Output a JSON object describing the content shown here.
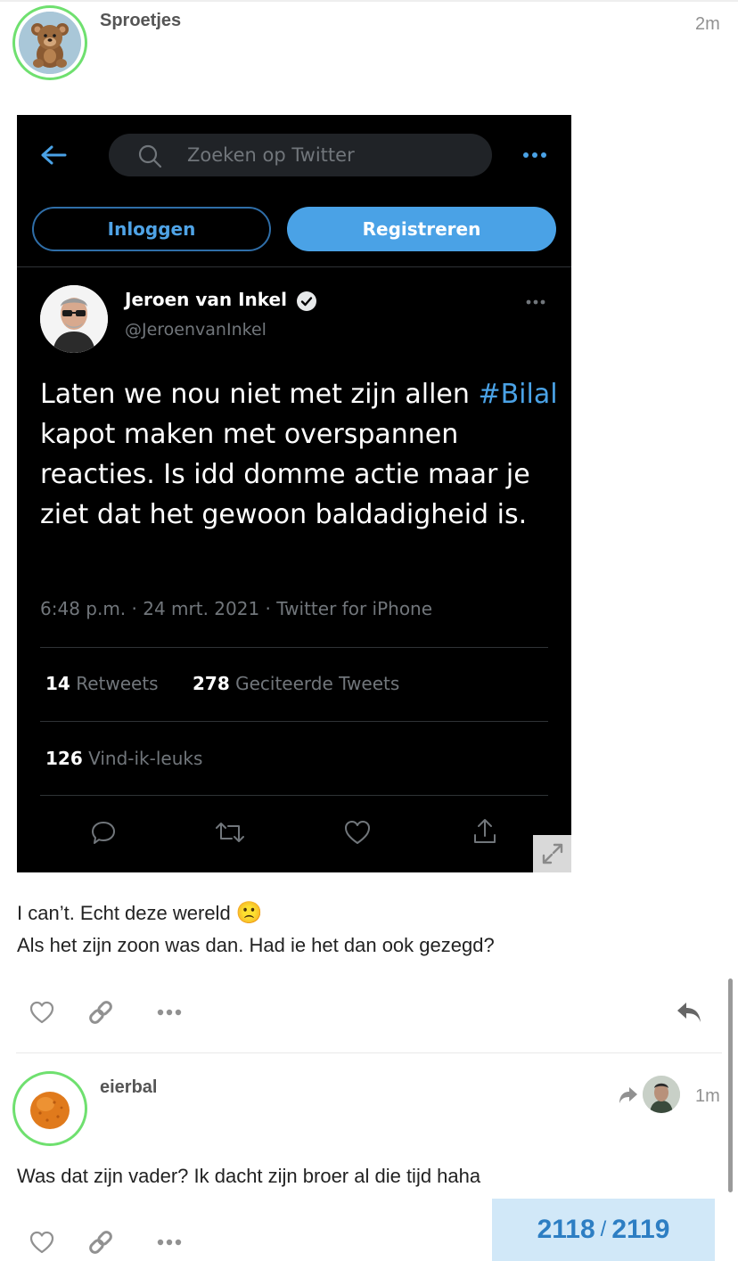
{
  "posts": [
    {
      "username": "Sproetjes",
      "time": "2m",
      "text_line1": "I can’t. Echt deze wereld",
      "text_line2": "Als het zijn zoon was dan. Had ie het dan ook gezegd?",
      "emoji": "🙁",
      "avatar": "teddy-bear-avatar"
    },
    {
      "username": "eierbal",
      "time": "1m",
      "text_line1": "Was dat zijn vader? Ik dacht zijn broer al die tijd haha",
      "avatar": "bitterbal-avatar",
      "reply_to_avatar": "reply-to-user-avatar"
    }
  ],
  "embedded_tweet": {
    "search_placeholder": "Zoeken op Twitter",
    "login_label": "Inloggen",
    "register_label": "Registreren",
    "author_name": "Jeroen van Inkel",
    "author_handle": "@JeroenvanInkel",
    "text_part1": "Laten we nou niet met zijn allen ",
    "hashtag": "#Bilal",
    "text_part2": " kapot maken met overspannen reacties. Is idd domme actie maar je ziet dat het gewoon baldadigheid is.",
    "meta": "6:48 p.m. · 24 mrt. 2021 · Twitter for iPhone",
    "retweets_count": "14",
    "retweets_label": "Retweets",
    "quotes_count": "278",
    "quotes_label": "Geciteerde Tweets",
    "likes_count": "126",
    "likes_label": "Vind-ik-leuks"
  },
  "progress": {
    "current": "2118",
    "separator": "/",
    "total": "2119"
  },
  "colors": {
    "avatar_ring": "#6fe06f",
    "twitter_blue": "#4aa2e6",
    "progress_bg": "#d1e8f8",
    "progress_text": "#2d7ec3"
  }
}
